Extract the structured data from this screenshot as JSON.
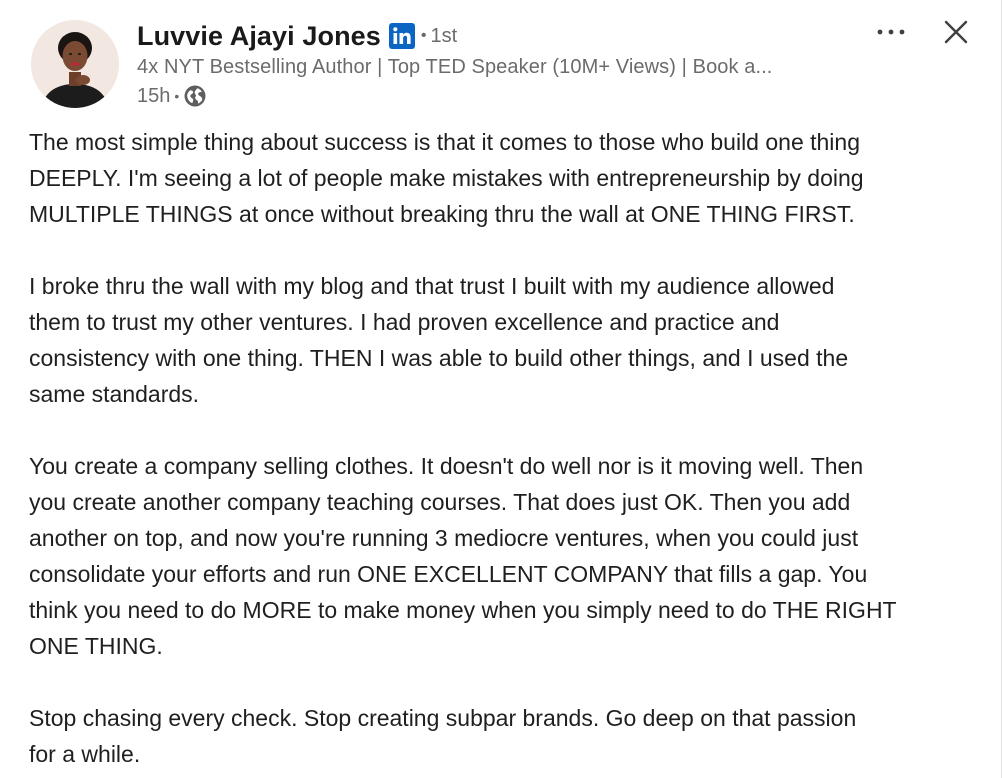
{
  "author": {
    "name": "Luvvie Ajayi Jones",
    "degree": "1st",
    "headline": "4x NYT Bestselling Author | Top TED Speaker (10M+ Views) | Book a...",
    "time": "15h",
    "network_icon": "linkedin-icon",
    "visibility_icon": "globe-icon"
  },
  "actions": {
    "more_icon": "ellipsis-icon",
    "close_icon": "close-icon"
  },
  "separators": {
    "dot": "•"
  },
  "colors": {
    "linkedin_blue": "#0a66c2",
    "muted_text": "#6b6b6b",
    "body_text": "#1f1f1f"
  },
  "post": {
    "paragraphs": [
      {
        "lines": [
          "The most simple thing about success is that it comes to those who build one thing",
          "DEEPLY. I'm seeing a lot of people make mistakes with entrepreneurship by doing",
          "MULTIPLE THINGS at once without breaking thru the wall at ONE THING FIRST."
        ]
      },
      {
        "lines": [
          "I broke thru the wall with my blog and that trust I built with my audience allowed",
          "them to trust my other ventures. I had proven excellence and practice and",
          "consistency with one thing. THEN I was able to build other things, and I used the",
          "same standards."
        ]
      },
      {
        "lines": [
          "You create a company selling clothes. It doesn't do well nor is it moving well. Then",
          "you create another company teaching courses. That does just OK. Then you add",
          "another on top, and now you're running 3 mediocre ventures, when you could just",
          "consolidate your efforts and run ONE EXCELLENT COMPANY that fills a gap. You",
          "think you need to do MORE to make money when you simply need to do THE RIGHT",
          "ONE THING."
        ]
      },
      {
        "lines": [
          "Stop chasing every check. Stop creating subpar brands. Go deep on that passion",
          "for a while."
        ]
      }
    ]
  }
}
